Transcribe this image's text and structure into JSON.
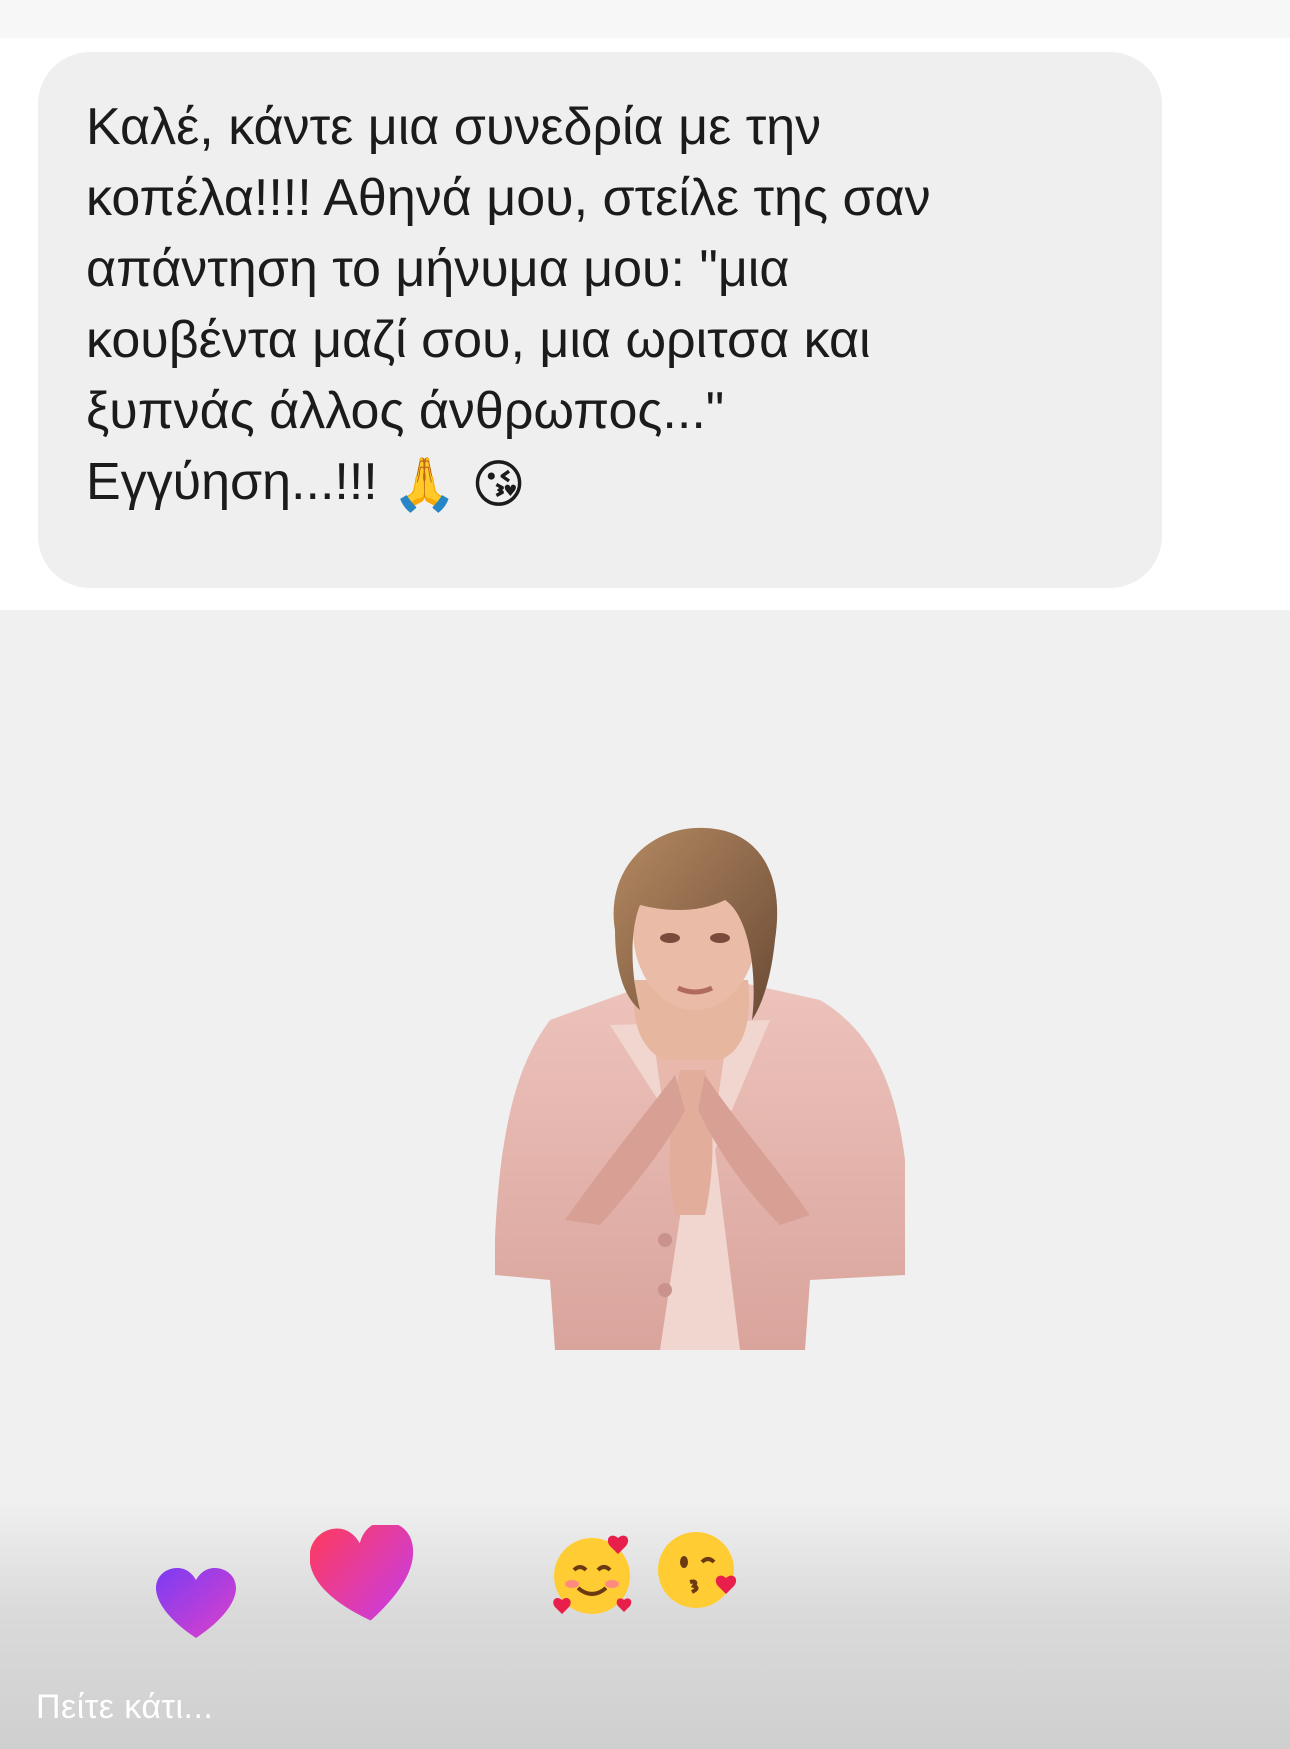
{
  "message": {
    "text": "Καλέ, κάντε μια συνεδρία με την\nκοπέλα!!!! Αθηνά μου, στείλε της σαν\nαπάντηση το μήνυμα μου: \"μια\nκουβέντα μαζί σου, μια ωριτσα και\nξυπνάς άλλος άνθρωπος...\"\nΕγγύηση...!!!",
    "emojis": [
      "🙏",
      "😘"
    ]
  },
  "sticker": {
    "icon": "woman-praying-hands-sticker"
  },
  "reactions": {
    "icons": [
      "purple-heart-icon",
      "pink-heart-icon",
      "smiling-face-with-hearts-icon",
      "face-blowing-kiss-icon"
    ]
  },
  "composer": {
    "placeholder": "Πείτε κάτι..."
  },
  "colors": {
    "bubble": "#efefef",
    "text": "#1b1b1b",
    "background": "#f0f0f0",
    "heart_gradient_start": "#ff3b5c",
    "heart_gradient_end": "#c43cf0"
  }
}
